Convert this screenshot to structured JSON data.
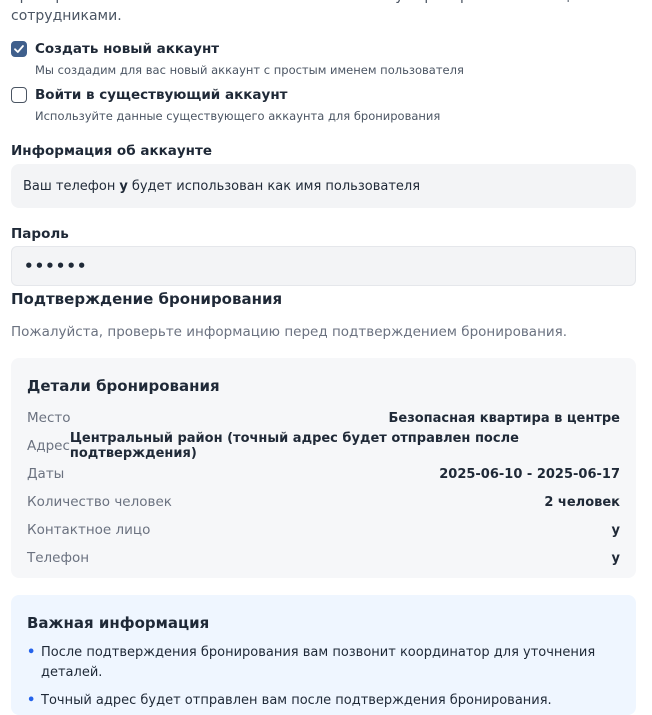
{
  "intro_text": "бронирований. Это позволит вам отслеживать статус бронирования и общаться с сотрудниками.",
  "account_options": [
    {
      "title": "Создать новый аккаунт",
      "description": "Мы создадим для вас новый аккаунт с простым именем пользователя",
      "checked": true
    },
    {
      "title": "Войти в существующий аккаунт",
      "description": "Используйте данные существующего аккаунта для бронирования",
      "checked": false
    }
  ],
  "account_info": {
    "label": "Информация об аккаунте",
    "text_before": "Ваш телефон",
    "phone": "у",
    "text_after": "будет использован как имя пользователя"
  },
  "password": {
    "label": "Пароль",
    "value": "••••••"
  },
  "confirmation": {
    "title": "Подтверждение бронирования",
    "subtitle": "Пожалуйста, проверьте информацию перед подтверждением бронирования."
  },
  "details": {
    "title": "Детали бронирования",
    "rows": [
      {
        "key": "Место",
        "value": "Безопасная квартира в центре"
      },
      {
        "key": "Адрес",
        "value": "Центральный район (точный адрес будет отправлен после подтверждения)"
      },
      {
        "key": "Даты",
        "value": "2025-06-10 - 2025-06-17"
      },
      {
        "key": "Количество человек",
        "value": "2 человек"
      },
      {
        "key": "Контактное лицо",
        "value": "у"
      },
      {
        "key": "Телефон",
        "value": "у"
      }
    ]
  },
  "important": {
    "title": "Важная информация",
    "items": [
      "После подтверждения бронирования вам позвонит координатор для уточнения деталей.",
      "Точный адрес будет отправлен вам после подтверждения бронирования."
    ]
  },
  "colors": {
    "accent": "#3f5f8c",
    "bullet": "#2563eb",
    "info_bg": "#eff6ff"
  }
}
